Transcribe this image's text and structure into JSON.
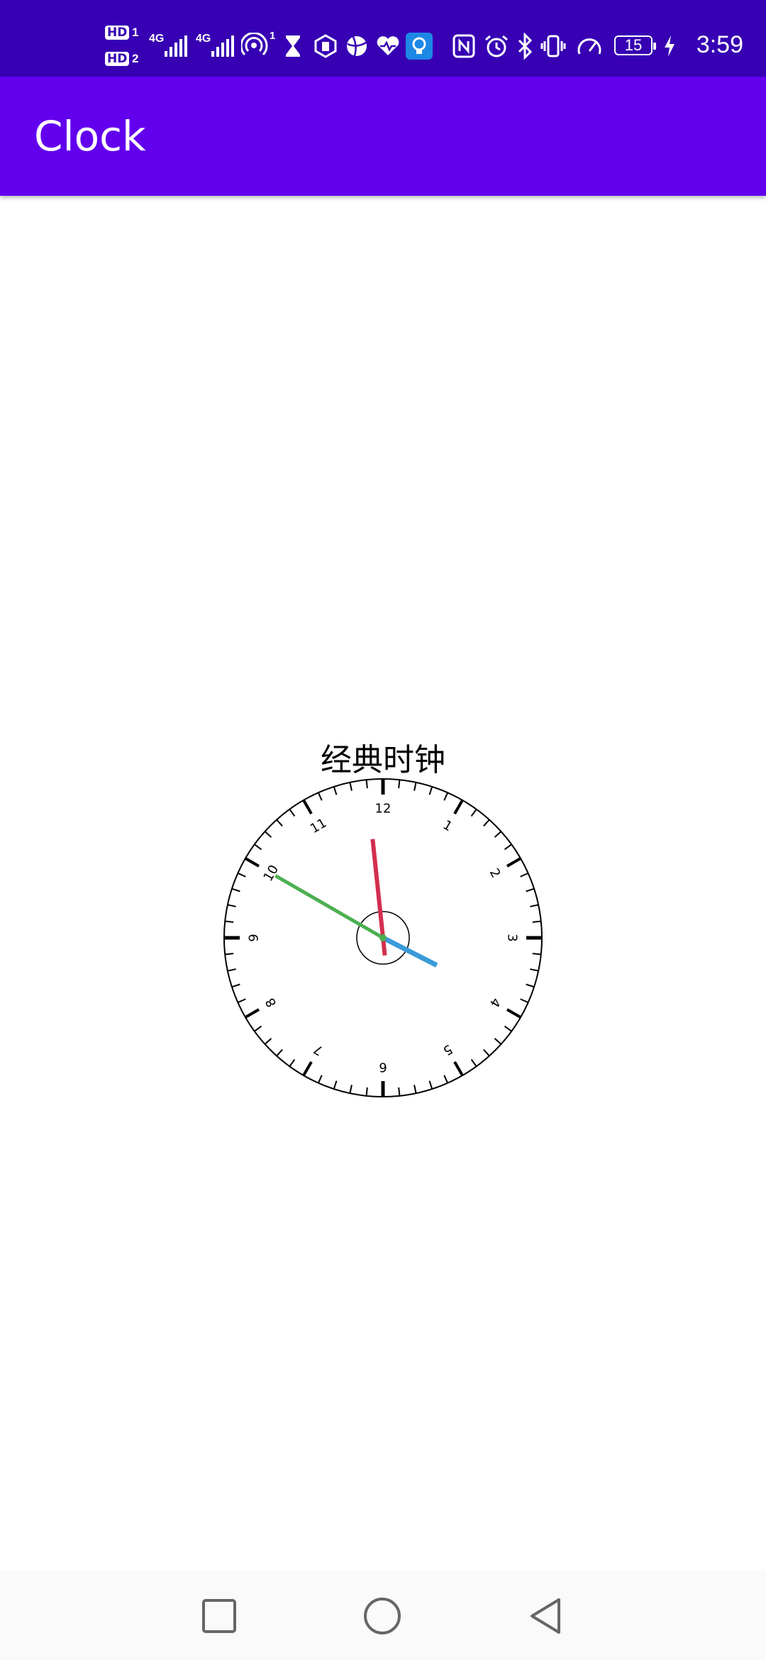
{
  "status_bar": {
    "sim1_badge": "HD",
    "sim1_num": "1",
    "sim2_badge": "HD",
    "sim2_num": "2",
    "net1": "4G",
    "net2": "4G",
    "hotspot_count": "1",
    "battery_level": "15",
    "time": "3:59",
    "icons": [
      "hotspot-icon",
      "hourglass-icon",
      "hexagon-hand-icon",
      "ball-icon",
      "heart-pulse-icon",
      "lightbulb-icon",
      "nfc-icon",
      "alarm-icon",
      "bluetooth-icon",
      "vibrate-icon",
      "speed-icon",
      "battery-icon",
      "charging-icon"
    ]
  },
  "app_bar": {
    "title": "Clock"
  },
  "main": {
    "clock_title": "经典时钟",
    "clock": {
      "numerals": [
        "12",
        "1",
        "2",
        "3",
        "4",
        "5",
        "6",
        "7",
        "8",
        "9",
        "10",
        "11"
      ],
      "time_shown": {
        "hour": 3.9,
        "minute": 50.0,
        "second": 59.0
      },
      "colors": {
        "hour_hand": "#3a9ad9",
        "minute_hand": "#4caf50",
        "second_hand": "#d32f4f"
      }
    }
  },
  "nav_bar": {
    "buttons": [
      "recent-apps-icon",
      "home-icon",
      "back-icon"
    ]
  }
}
